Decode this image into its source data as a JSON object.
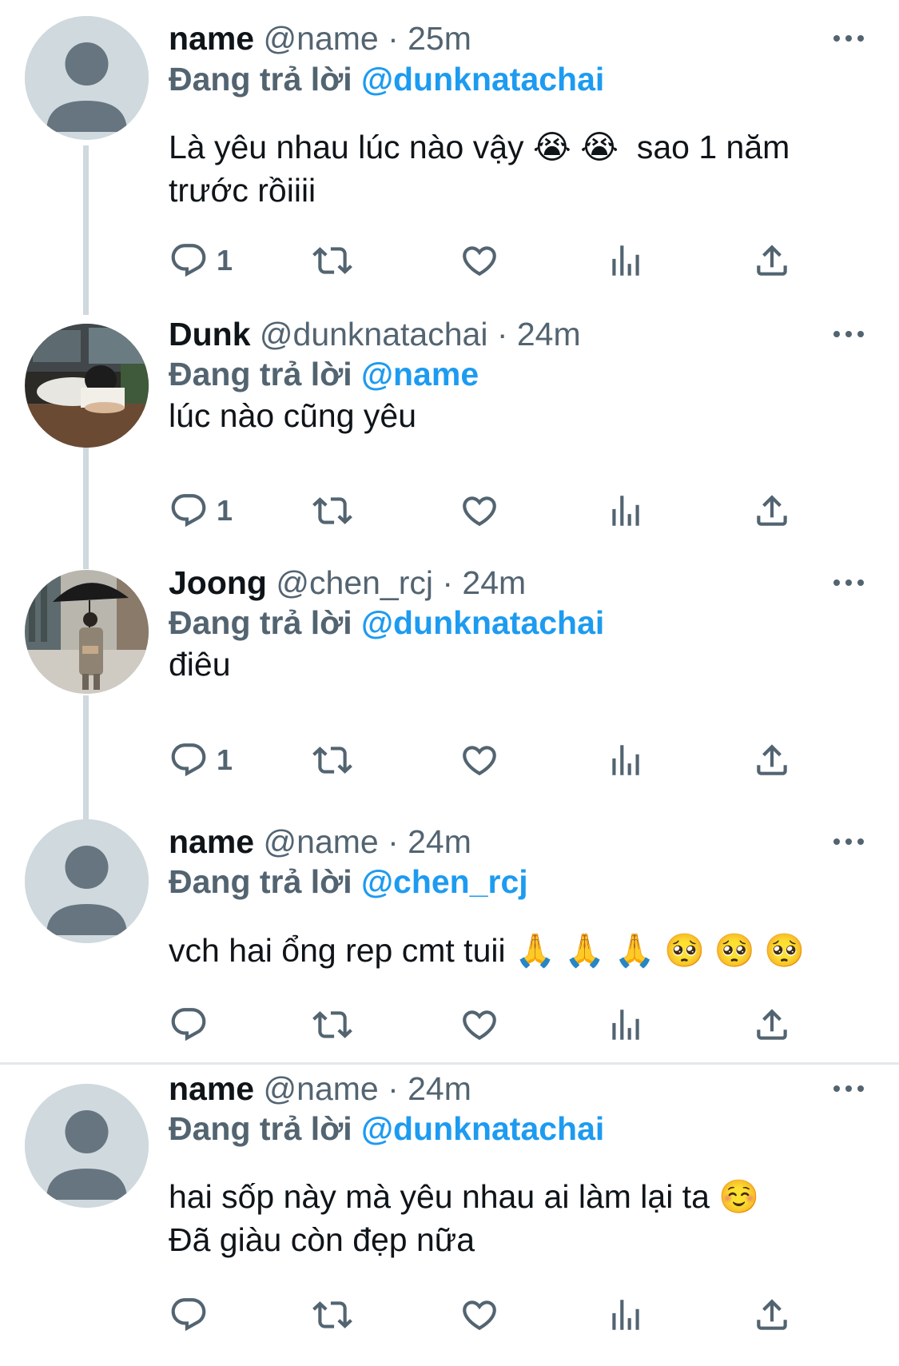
{
  "colors": {
    "link": "#1d9bf0",
    "meta": "#536471",
    "text": "#0f1419",
    "thread_line": "#cfd9de"
  },
  "reply_prefix": "Đang trả lời",
  "tweets": [
    {
      "name": "name",
      "meta": "@name · 25m",
      "reply_to": "@dunknatachai",
      "text": "Là yêu nhau lúc nào vậy 😭 😭  sao 1 năm\ntrước rồiiii",
      "reply_count": "1",
      "avatar": "default-avatar-icon"
    },
    {
      "name": "Dunk",
      "meta": "@dunknatachai · 24m",
      "reply_to": "@name",
      "text": "lúc nào cũng yêu",
      "reply_count": "1",
      "avatar": "dunk-photo-avatar"
    },
    {
      "name": "Joong",
      "meta": "@chen_rcj · 24m",
      "reply_to": "@dunknatachai",
      "text": "điêu",
      "reply_count": "1",
      "avatar": "joong-photo-avatar"
    },
    {
      "name": "name",
      "meta": "@name · 24m",
      "reply_to": "@chen_rcj",
      "text": "vch hai ổng rep cmt tuii 🙏 🙏 🙏 🥺 🥺 🥺",
      "reply_count": "",
      "avatar": "default-avatar-icon"
    },
    {
      "name": "name",
      "meta": "@name · 24m",
      "reply_to": "@dunknatachai",
      "text": "hai sốp này mà yêu nhau ai làm lại ta ☺️\nĐã giàu còn đẹp nữa",
      "reply_count": "",
      "avatar": "default-avatar-icon"
    }
  ]
}
